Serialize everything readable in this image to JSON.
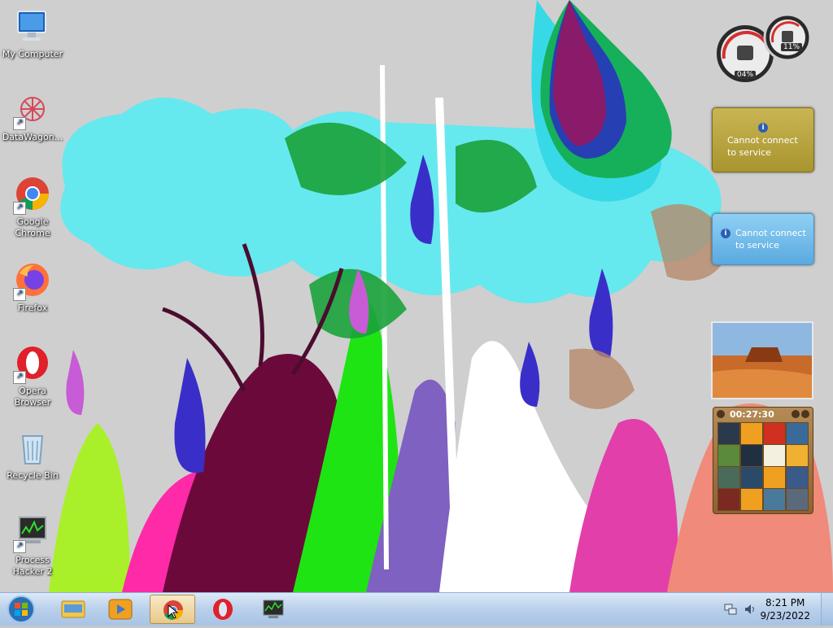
{
  "desktop": {
    "icons": [
      {
        "label": "My Computer"
      },
      {
        "label": "DataWagon..."
      },
      {
        "label": "Google Chrome"
      },
      {
        "label": "Firefox"
      },
      {
        "label": "Opera Browser"
      },
      {
        "label": "Recycle Bin"
      },
      {
        "label": "Process Hacker 2"
      }
    ]
  },
  "gadgets": {
    "cpu_meter": {
      "cpu": "04%",
      "memory": "11%"
    },
    "currency": {
      "message": "Cannot connect to service"
    },
    "weather": {
      "message": "Cannot connect to service"
    },
    "puzzle": {
      "timer": "00:27:30"
    }
  },
  "taskbar": {
    "clock_time": "8:21 PM",
    "clock_date": "9/23/2022",
    "start_icon": "windows-orb-icon",
    "pinned": [
      "explorer-icon",
      "media-player-icon",
      "chrome-icon",
      "opera-icon",
      "process-hacker-icon"
    ]
  }
}
